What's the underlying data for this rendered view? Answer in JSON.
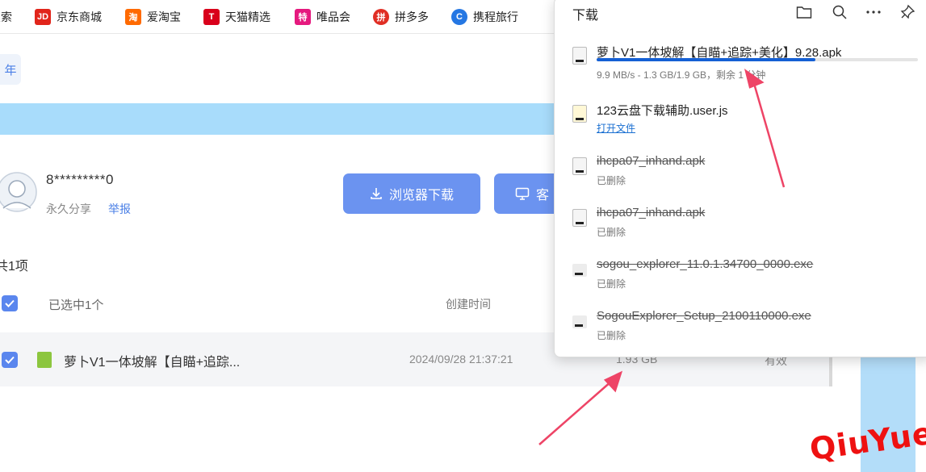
{
  "bookmarks": [
    {
      "label": "搜索",
      "icon": "search-icon"
    },
    {
      "label": "京东商城",
      "icon": "jd-logo-icon",
      "badge": "JD",
      "color": "#e1251b"
    },
    {
      "label": "爱淘宝",
      "icon": "taobao-logo-icon",
      "badge": "淘",
      "color": "#ff6a00"
    },
    {
      "label": "天猫精选",
      "icon": "tmall-logo-icon",
      "badge": "T",
      "color": "#d9001b"
    },
    {
      "label": "唯品会",
      "icon": "vip-logo-icon",
      "badge": "特",
      "color": "#e5197e"
    },
    {
      "label": "拼多多",
      "icon": "pinduoduo-logo-icon",
      "badge": "拼",
      "color": "#e02e24"
    },
    {
      "label": "携程旅行",
      "icon": "ctrip-logo-icon",
      "badge": "C",
      "color": "#2577e3"
    }
  ],
  "page": {
    "tab_label": "年",
    "user_name": "8*********0",
    "share_type": "永久分享",
    "report_label": "举报",
    "download_button": "浏览器下载",
    "client_button": "客",
    "total": "共1项",
    "selected": "已选中1个",
    "column_created": "创建时间",
    "file": {
      "name": "萝卜V1一体坡解【自瞄+追踪...",
      "created": "2024/09/28 21:37:21",
      "size": "1.93 GB",
      "status": "有效"
    }
  },
  "downloads": {
    "title": "下载",
    "items": [
      {
        "name": "萝卜V1一体坡解【自瞄+追踪+美化】9.28.apk",
        "status": "9.9 MB/s - 1.3 GB/1.9 GB，剩余 1 分钟",
        "progress": 0.68,
        "state": "downloading"
      },
      {
        "name": "123云盘下载辅助.user.js",
        "status": "打开文件",
        "state": "done"
      },
      {
        "name": "ihcpa07_inhand.apk",
        "status": "已删除",
        "state": "deleted"
      },
      {
        "name": "ihcpa07_inhand.apk",
        "status": "已删除",
        "state": "deleted"
      },
      {
        "name": "sogou_explorer_11.0.1.34700_0000.exe",
        "status": "已删除",
        "state": "deleted"
      },
      {
        "name": "SogouExplorer_Setup_2100110000.exe",
        "status": "已删除",
        "state": "deleted"
      }
    ]
  },
  "watermark": {
    "left": "Qiu",
    "right": "Yue"
  },
  "colors": {
    "accent": "#5a86ee",
    "progress": "#1560d4",
    "arrow": "#ee4466",
    "watermark": "#ee1111"
  }
}
